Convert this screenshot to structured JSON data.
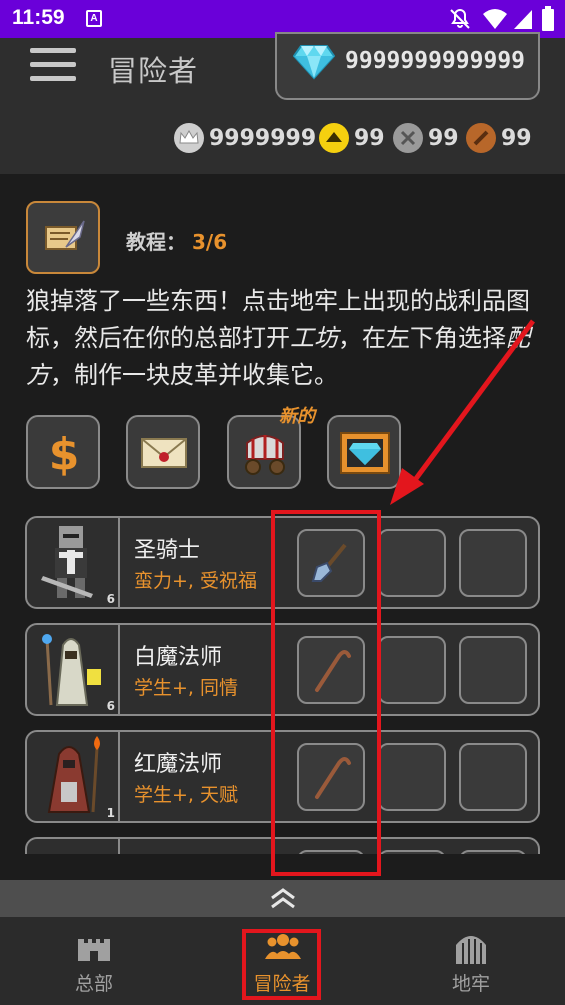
{
  "status_bar": {
    "time": "11:59",
    "notif_letter": "A"
  },
  "header": {
    "title": "冒险者",
    "gems": "9999999999999",
    "currencies": [
      {
        "name": "crown",
        "value": "9999999"
      },
      {
        "name": "gold-token",
        "value": "99"
      },
      {
        "name": "silver-token",
        "value": "99"
      },
      {
        "name": "bronze-token",
        "value": "99"
      }
    ]
  },
  "tutorial": {
    "label": "教程：",
    "progress": "3/6",
    "text_part1": "狼掉落了一些东西！点击地牢上出现的战利品图标，然后在你的总部打开",
    "text_em1": "工坊",
    "text_part2": "，在左下角选择",
    "text_em2": "配方",
    "text_part3": "，制作一块皮革并收集它。"
  },
  "actions": {
    "new_label": "新的",
    "items": [
      "gold-icon",
      "letter-icon",
      "caravan-icon",
      "gem-video-icon"
    ]
  },
  "heroes": [
    {
      "name": "圣骑士",
      "traits": "蛮力+, 受祝福",
      "level": "6",
      "slot1": "shovel-icon"
    },
    {
      "name": "白魔法师",
      "traits": "学生+, 同情",
      "level": "6",
      "slot1": "cane-icon"
    },
    {
      "name": "红魔法师",
      "traits": "学生+, 天赋",
      "level": "1",
      "slot1": "cane-icon"
    }
  ],
  "nav": [
    {
      "label": "总部",
      "icon": "castle-icon"
    },
    {
      "label": "冒险者",
      "icon": "group-icon"
    },
    {
      "label": "地牢",
      "icon": "dungeon-gate-icon"
    }
  ],
  "colors": {
    "accent": "#e8922d",
    "highlight": "#e3161d",
    "statusbar": "#6a00d9"
  }
}
